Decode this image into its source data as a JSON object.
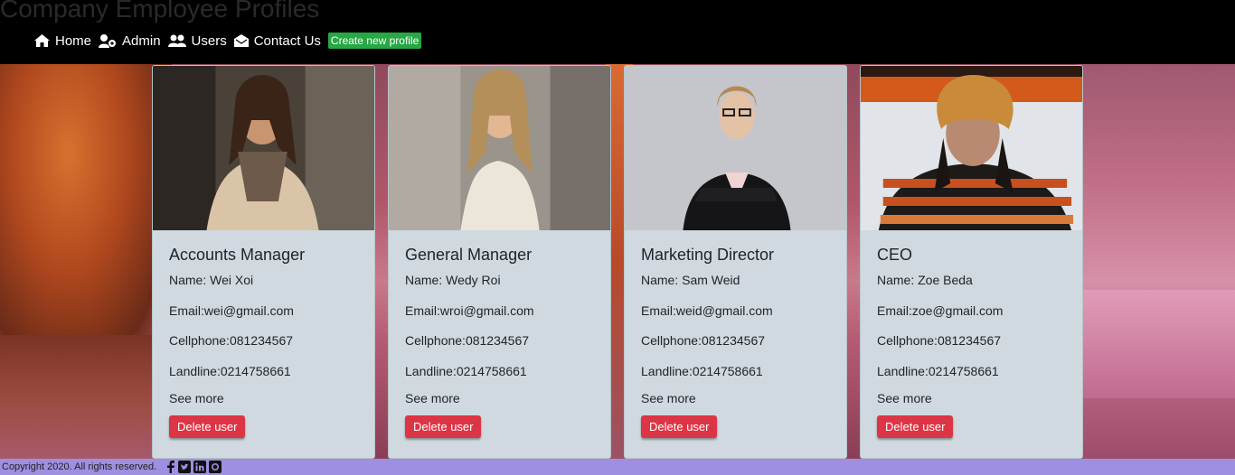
{
  "header": {
    "title": "Company Employee Profiles",
    "nav": [
      {
        "label": "Home",
        "icon": "home-icon"
      },
      {
        "label": "Admin",
        "icon": "admin-icon"
      },
      {
        "label": "Users",
        "icon": "users-icon"
      },
      {
        "label": "Contact Us",
        "icon": "envelope-icon"
      }
    ],
    "create_label": "Create new profile"
  },
  "colors": {
    "create_button": "#28a745",
    "delete_button": "#dc3545",
    "card_background": "#d0d9df",
    "footer_background": "#9f8fe0"
  },
  "employees": [
    {
      "role": "Accounts Manager",
      "name": "Name: Wei Xoi",
      "email": "Email:wei@gmail.com",
      "cellphone": "Cellphone:081234567",
      "landline": "Landline:0214758661"
    },
    {
      "role": "General Manager",
      "name": "Name: Wedy Roi",
      "email": "Email:wroi@gmail.com",
      "cellphone": "Cellphone:081234567",
      "landline": "Landline:0214758661"
    },
    {
      "role": "Marketing Director",
      "name": "Name: Sam Weid",
      "email": "Email:weid@gmail.com",
      "cellphone": "Cellphone:081234567",
      "landline": "Landline:0214758661"
    },
    {
      "role": "CEO",
      "name": "Name: Zoe Beda",
      "email": "Email:zoe@gmail.com",
      "cellphone": "Cellphone:081234567",
      "landline": "Landline:0214758661"
    }
  ],
  "card_actions": {
    "see_more": "See more",
    "delete": "Delete user"
  },
  "footer": {
    "copyright": "Copyright 2020. All rights reserved.",
    "social_icons": [
      "facebook-icon",
      "twitter-icon",
      "linkedin-icon",
      "github-icon"
    ]
  }
}
